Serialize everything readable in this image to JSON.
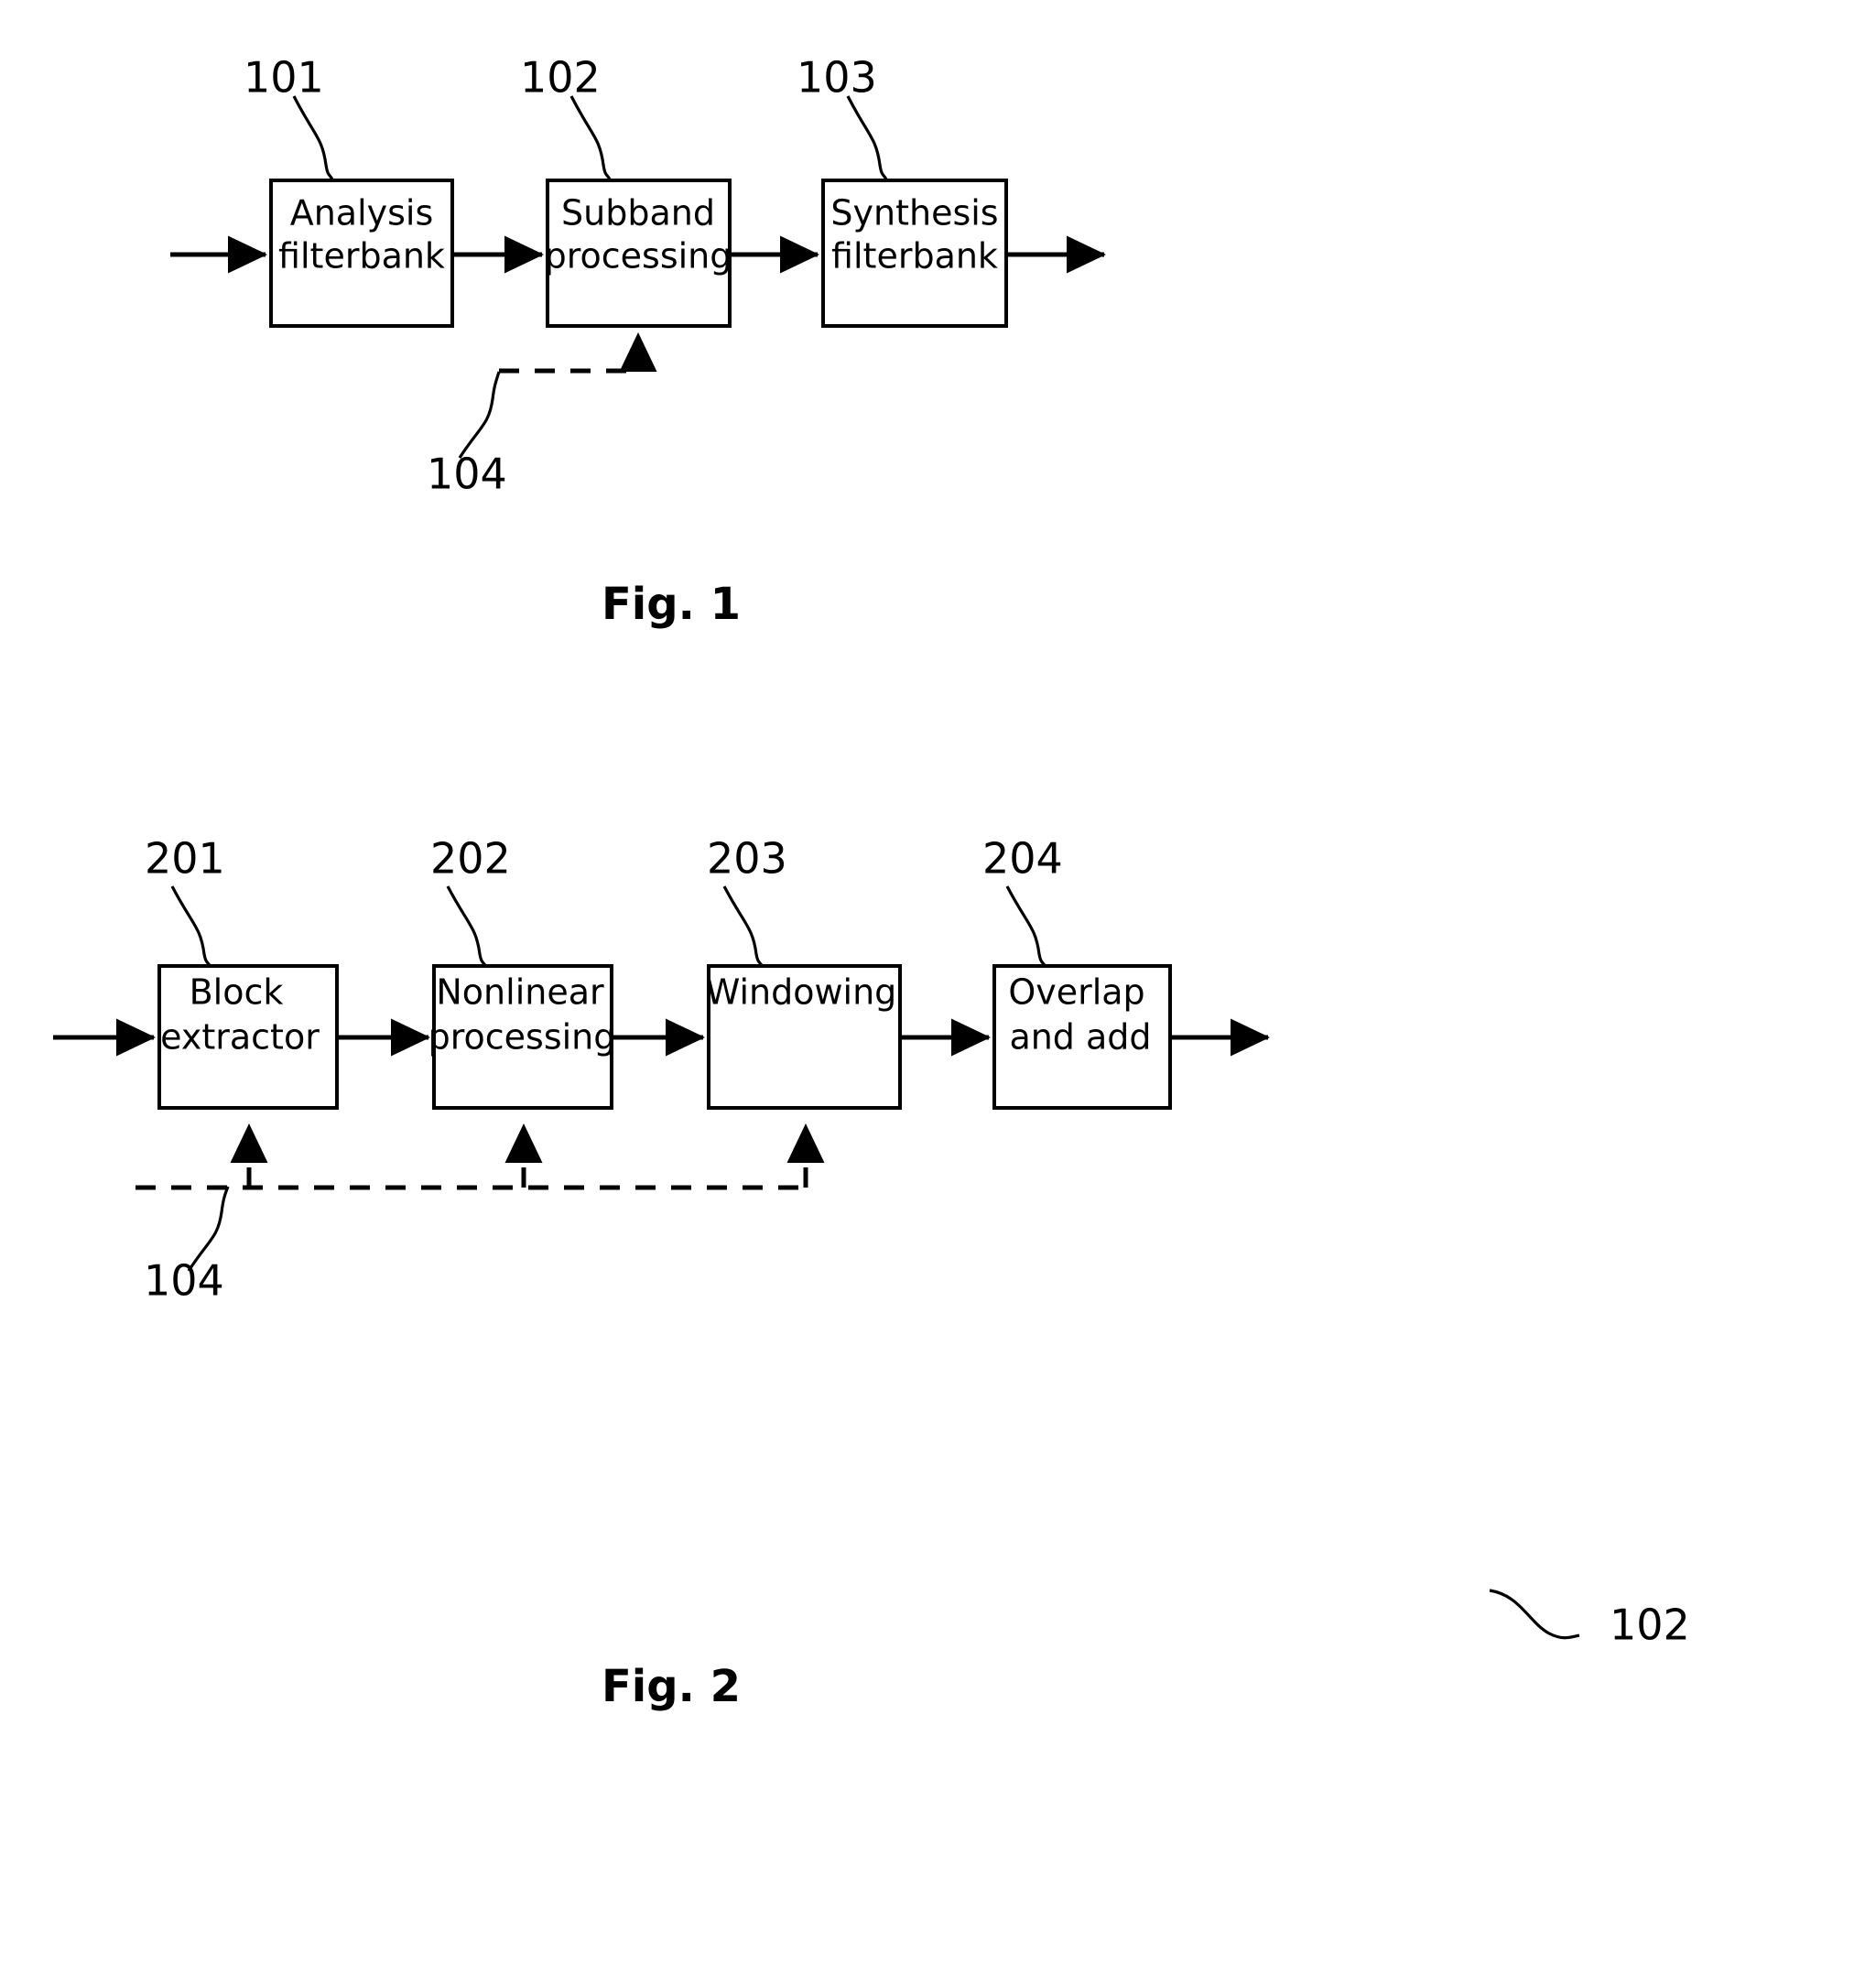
{
  "page": {
    "background_color": "#ffffff",
    "ink_color": "#000000",
    "type": "patent-drawing-sheet"
  },
  "figures": [
    {
      "id": "figure-1",
      "caption": "Fig. 1",
      "blocks": [
        {
          "ref": "101",
          "line1": "Analysis",
          "line2": "filterbank"
        },
        {
          "ref": "102",
          "line1": "Subband",
          "line2": "processing"
        },
        {
          "ref": "103",
          "line1": "Synthesis",
          "line2": "filterbank"
        }
      ],
      "control": {
        "ref": "104"
      }
    },
    {
      "id": "figure-2",
      "caption": "Fig. 2",
      "blocks": [
        {
          "ref": "201",
          "line1": "Block",
          "line2": "extractor"
        },
        {
          "ref": "202",
          "line1": "Nonlinear",
          "line2": "processing"
        },
        {
          "ref": "203",
          "line1": "Windowing",
          "line2": ""
        },
        {
          "ref": "204",
          "line1": "Overlap",
          "line2": "and add"
        }
      ],
      "control": {
        "ref": "104"
      },
      "assembly": {
        "ref": "102"
      }
    }
  ]
}
